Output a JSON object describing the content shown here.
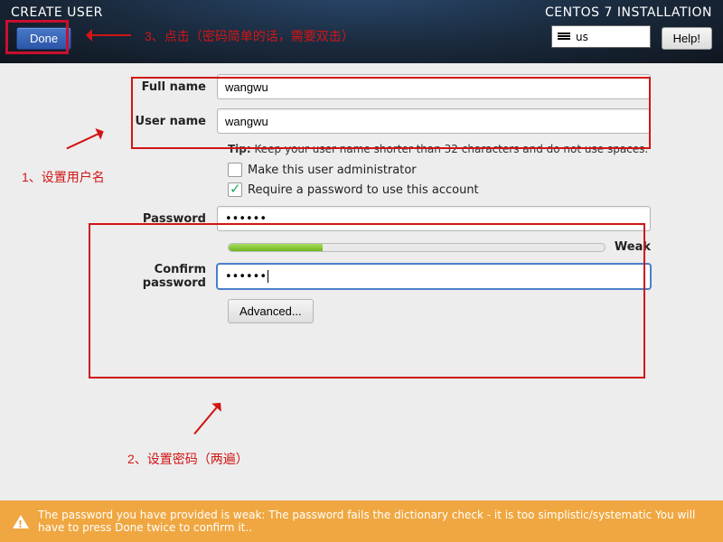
{
  "header": {
    "title_left": "CREATE USER",
    "title_right": "CENTOS 7 INSTALLATION",
    "done_label": "Done",
    "help_label": "Help!",
    "keyboard_layout": "us"
  },
  "form": {
    "fullname_label": "Full name",
    "fullname_value": "wangwu",
    "username_label": "User name",
    "username_value": "wangwu",
    "tip_prefix": "Tip:",
    "tip_text": " Keep your user name shorter than 32 characters and do not use spaces.",
    "make_admin_label": "Make this user administrator",
    "make_admin_checked": false,
    "require_pw_label": "Require a password to use this account",
    "require_pw_checked": true,
    "password_label": "Password",
    "password_value": "••••••",
    "strength_label": "Weak",
    "confirm_label": "Confirm password",
    "confirm_value": "••••••",
    "advanced_label": "Advanced..."
  },
  "annotations": {
    "step1": "1、设置用户名",
    "step2": "2、设置密码（两遍）",
    "step3": "3、点击（密码简单的话，需要双击）"
  },
  "warning": {
    "text": "The password you have provided is weak: The password fails the dictionary check - it is too simplistic/systematic You will have to press Done twice to confirm it.."
  }
}
